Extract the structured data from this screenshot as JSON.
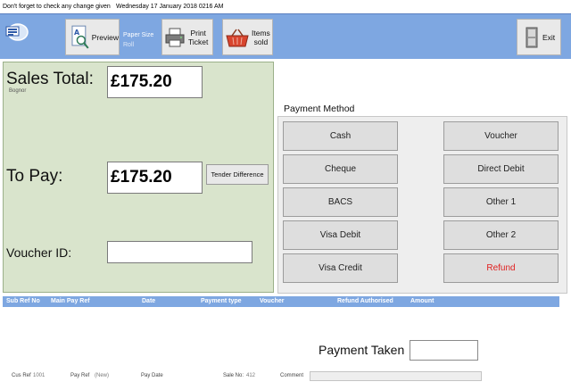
{
  "titlebar": {
    "message": "Don't forget to check any change given",
    "datetime": "Wednesday 17 January 2018    0216 AM"
  },
  "toolbar": {
    "preview_label": "Preview",
    "paper_size_label": "Paper Size",
    "paper_size_value": "Roll",
    "print_label_1": "Print",
    "print_label_2": "Ticket",
    "items_label_1": "Items",
    "items_label_2": "sold",
    "exit_label": "Exit"
  },
  "sales": {
    "sales_total_label": "Sales Total:",
    "sales_total_value": "£175.20",
    "branch": "Bognor",
    "to_pay_label": "To Pay:",
    "to_pay_value": "£175.20",
    "tender_difference_label": "Tender Difference",
    "voucher_id_label": "Voucher ID:",
    "voucher_id_value": ""
  },
  "payment_method": {
    "title": "Payment Method",
    "left": [
      "Cash",
      "Cheque",
      "BACS",
      "Visa Debit",
      "Visa Credit"
    ],
    "right": [
      "Voucher",
      "Direct Debit",
      "Other 1",
      "Other 2",
      "Refund"
    ]
  },
  "grid": {
    "columns": [
      "Sub Ref No",
      "Main Pay  Ref",
      "Date",
      "Payment  type",
      "Voucher",
      "Refund Authorised",
      "Amount"
    ]
  },
  "bottom": {
    "payment_taken_label": "Payment Taken",
    "payment_taken_value": "",
    "cus_ref_label": "Cus Ref",
    "cus_ref_value": "1001",
    "pay_ref_label": "Pay Ref",
    "pay_ref_value": "(New)",
    "pay_date_label": "Pay Date",
    "sale_no_label": "Sale No:",
    "sale_no_value": "412",
    "comment_label": "Comment"
  },
  "colors": {
    "toolbar_bg": "#7ea7e1",
    "sales_panel_bg": "#d9e4cc",
    "refund_text": "#e02020"
  }
}
